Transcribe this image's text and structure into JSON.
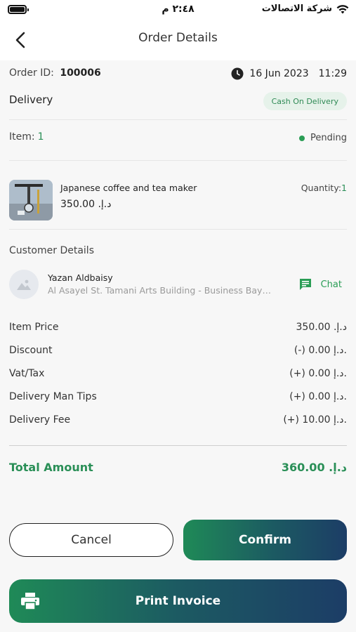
{
  "status_bar": {
    "time": "٢:٤٨ م",
    "carrier": "شركة الاتصالات"
  },
  "header": {
    "title": "Order Details"
  },
  "order": {
    "id_label": "Order ID:",
    "id_value": "100006",
    "date": "16 Jun 2023",
    "time": "11:29",
    "type": "Delivery",
    "payment_badge": "Cash On Delivery",
    "items_label": "Item:",
    "items_count": "1",
    "status": "Pending"
  },
  "product": {
    "name": "Japanese coffee and tea maker",
    "price": "د.إ. 350.00",
    "quantity_label": "Quantity:",
    "quantity_value": "1"
  },
  "customer": {
    "section_title": "Customer Details",
    "name": "Yazan Aldbaisy",
    "address": "Al Asayel St. Tamani Arts Building - Business Bay - ...",
    "chat_label": "Chat"
  },
  "summary": {
    "rows": [
      {
        "label": "Item Price",
        "value": "د.إ. 350.00"
      },
      {
        "label": "Discount",
        "value": "(-) 0.00 د.إ."
      },
      {
        "label": "Vat/Tax",
        "value": "(+) 0.00 د.إ."
      },
      {
        "label": "Delivery Man Tips",
        "value": "(+) 0.00 د.إ."
      },
      {
        "label": "Delivery Fee",
        "value": "(+) 10.00 د.إ."
      }
    ],
    "total_label": "Total Amount",
    "total_value": "د.إ. 360.00"
  },
  "actions": {
    "cancel_label": "Cancel",
    "confirm_label": "Confirm",
    "print_label": "Print Invoice"
  },
  "colors": {
    "accent_green": "#2a8f57",
    "gradient_start": "#1f8a57",
    "gradient_end": "#1c3d66"
  }
}
